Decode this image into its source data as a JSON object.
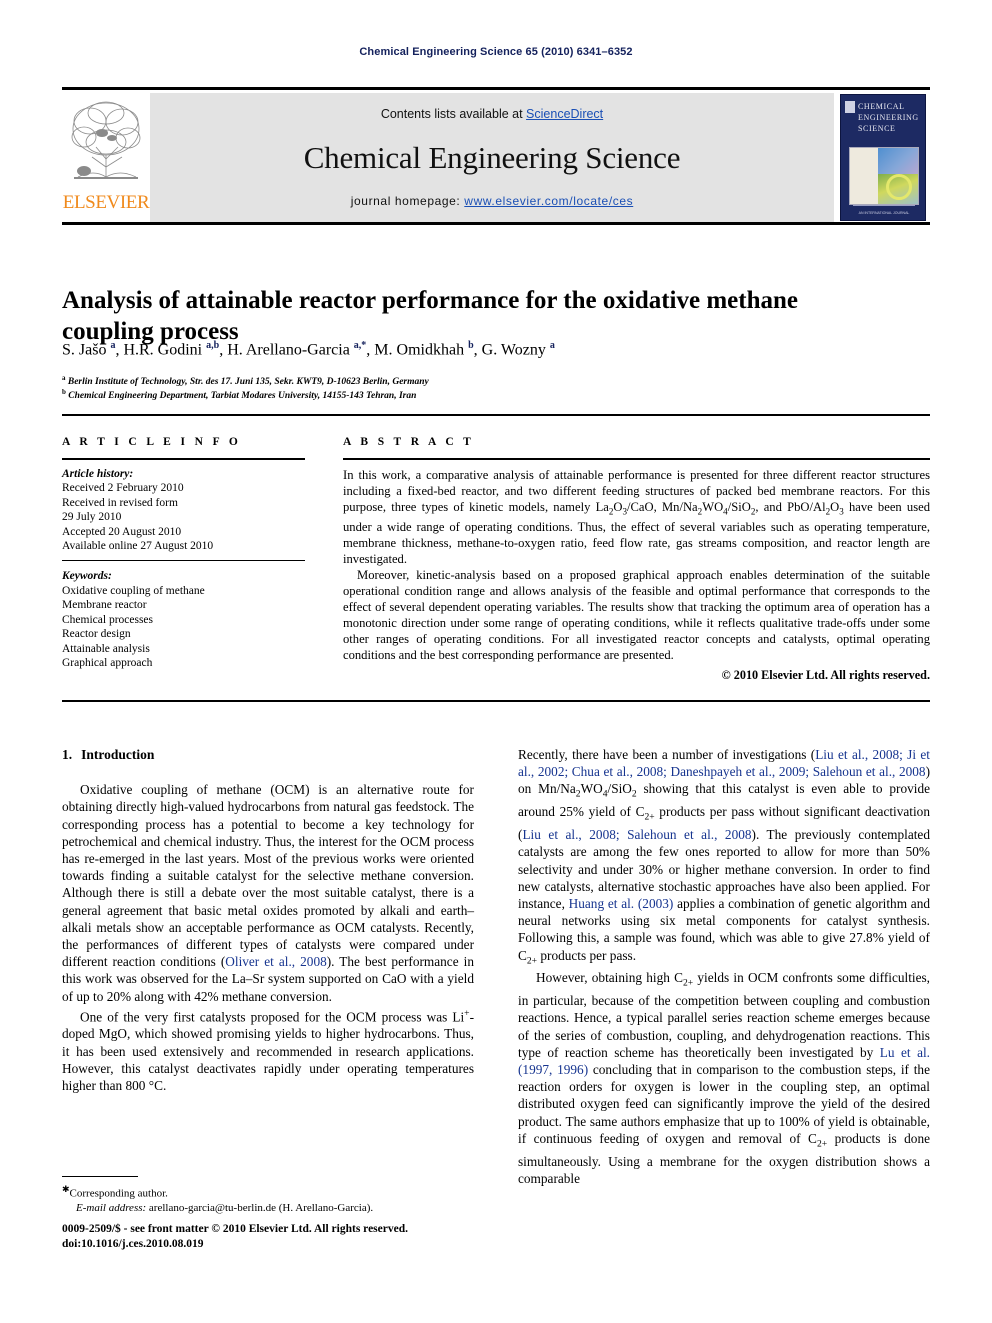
{
  "running_head": "Chemical Engineering Science 65 (2010) 6341–6352",
  "masthead": {
    "contents_prefix": "Contents lists available at ",
    "sciencedirect": "ScienceDirect",
    "journal_name": "Chemical Engineering Science",
    "homepage_prefix": "journal homepage: ",
    "homepage_url": "www.elsevier.com/locate/ces",
    "elsevier_wordmark": "ELSEVIER",
    "cover_title_line1": "CHEMICAL",
    "cover_title_line2": "ENGINEERING",
    "cover_title_line3": "SCIENCE",
    "cover_footer": "AN INTERNATIONAL JOURNAL",
    "accent_blue": "#1a4fb5",
    "elsevier_orange": "#f08a1c",
    "cover_navy": "#1d2a63"
  },
  "article": {
    "title": "Analysis of attainable reactor performance for the oxidative methane coupling process",
    "authors_html": "S. Ja&#353;o <sup>a</sup>, H.R. Godini <sup>a,b</sup>, H. Arellano-Garcia <sup>a,*</sup>, M. Omidkhah <sup>b</sup>, G. Wozny <sup>a</sup>",
    "affiliation_a": "Berlin Institute of Technology, Str. des 17. Juni 135, Sekr. KWT9, D-10623 Berlin, Germany",
    "affiliation_b": "Chemical Engineering Department, Tarbiat Modares University, 14155-143 Tehran, Iran"
  },
  "article_info": {
    "heading": "A R T I C L E   I N F O",
    "history_label": "Article history:",
    "history_lines": [
      "Received 2 February 2010",
      "Received in revised form",
      "29 July 2010",
      "Accepted 20 August 2010",
      "Available online 27 August 2010"
    ],
    "keywords_label": "Keywords:",
    "keywords": [
      "Oxidative coupling of methane",
      "Membrane reactor",
      "Chemical processes",
      "Reactor design",
      "Attainable analysis",
      "Graphical approach"
    ]
  },
  "abstract": {
    "heading": "A B S T R A C T",
    "paragraph_1_html": "In this work, a comparative analysis of attainable performance is presented for three different reactor structures including a fixed-bed reactor, and two different feeding structures of packed bed membrane reactors. For this purpose, three types of kinetic models, namely La<sub>2</sub>O<sub>3</sub>/CaO, Mn/Na<sub>2</sub>WO<sub>4</sub>/SiO<sub>2</sub>, and PbO/Al<sub>2</sub>O<sub>3</sub> have been used under a wide range of operating conditions. Thus, the effect of several variables such as operating temperature, membrane thickness, methane-to-oxygen ratio, feed flow rate, gas streams composition, and reactor length are investigated.",
    "paragraph_2_html": "Moreover, kinetic-analysis based on a proposed graphical approach enables determination of the suitable operational condition range and allows analysis of the feasible and optimal performance that corresponds to the effect of several dependent operating variables. The results show that tracking the optimum area of operation has a monotonic direction under some range of operating conditions, while it reflects qualitative trade-offs under some other ranges of operating conditions. For all investigated reactor concepts and catalysts, optimal operating conditions and the best corresponding performance are presented.",
    "copyright": "© 2010 Elsevier Ltd. All rights reserved."
  },
  "body": {
    "section_number": "1.",
    "section_title": "Introduction",
    "left_paragraphs_html": [
      "Oxidative coupling of methane (OCM) is an alternative route for obtaining directly high-valued hydrocarbons from natural gas feedstock. The corresponding process has a potential to become a key technology for petrochemical and chemical industry. Thus, the interest for the OCM process has re-emerged in the last years. Most of the previous works were oriented towards finding a suitable catalyst for the selective methane conversion. Although there is still a debate over the most suitable catalyst, there is a general agreement that basic metal oxides promoted by alkali and earth–alkali metals show an acceptable performance as OCM catalysts. Recently, the performances of different types of catalysts were compared under different reaction conditions (<span class=\"cite\">Oliver et al., 2008</span>). The best performance in this work was observed for the La–Sr system supported on CaO with a yield of up to 20% along with 42% methane conversion.",
      "One of the very first catalysts proposed for the OCM process was Li<sup class=\"chem\">+</sup>-doped MgO, which showed promising yields to higher hydrocarbons. Thus, it has been used extensively and recommended in research applications. However, this catalyst deactivates rapidly under operating temperatures higher than 800 °C."
    ],
    "right_paragraphs_html": [
      "Recently, there have been a number of investigations (<span class=\"cite\">Liu et al., 2008; Ji et al., 2002; Chua et al., 2008; Daneshpayeh et al., 2009; Salehoun et al., 2008</span>) on Mn/Na<sub>2</sub>WO<sub>4</sub>/SiO<sub>2</sub> showing that this catalyst is even able to provide around 25% yield of C<sub>2+</sub> products per pass without significant deactivation (<span class=\"cite\">Liu et al., 2008; Salehoun et al., 2008</span>). The previously contemplated catalysts are among the few ones reported to allow for more than 50% selectivity and under 30% or higher methane conversion. In order to find new catalysts, alternative stochastic approaches have also been applied. For instance, <span class=\"cite\">Huang et al. (2003)</span> applies a combination of genetic algorithm and neural networks using six metal components for catalyst synthesis. Following this, a sample was found, which was able to give 27.8% yield of C<sub>2+</sub> products per pass.",
      "However, obtaining high C<sub>2+</sub> yields in OCM confronts some difficulties, in particular, because of the competition between coupling and combustion reactions. Hence, a typical parallel series reaction scheme emerges because of the series of combustion, coupling, and dehydrogenation reactions. This type of reaction scheme has theoretically been investigated by <span class=\"cite\">Lu et al. (1997, 1996)</span> concluding that in comparison to the combustion steps, if the reaction orders for oxygen is lower in the coupling step, an optimal distributed oxygen feed can significantly improve the yield of the desired product. The same authors emphasize that up to 100% of yield is obtainable, if continuous feeding of oxygen and removal of C<sub>2+</sub> products is done simultaneously. Using a membrane for the oxygen distribution shows a comparable"
    ]
  },
  "footnotes": {
    "corresponding_author": "Corresponding author.",
    "email_label": "E-mail address:",
    "email_value": "arellano-garcia@tu-berlin.de (H. Arellano-Garcia).",
    "imprint_line1_html": "0009-2509/$ - see front matter &copy; 2010 Elsevier Ltd. All rights reserved.",
    "imprint_line2": "doi:10.1016/j.ces.2010.08.019"
  }
}
